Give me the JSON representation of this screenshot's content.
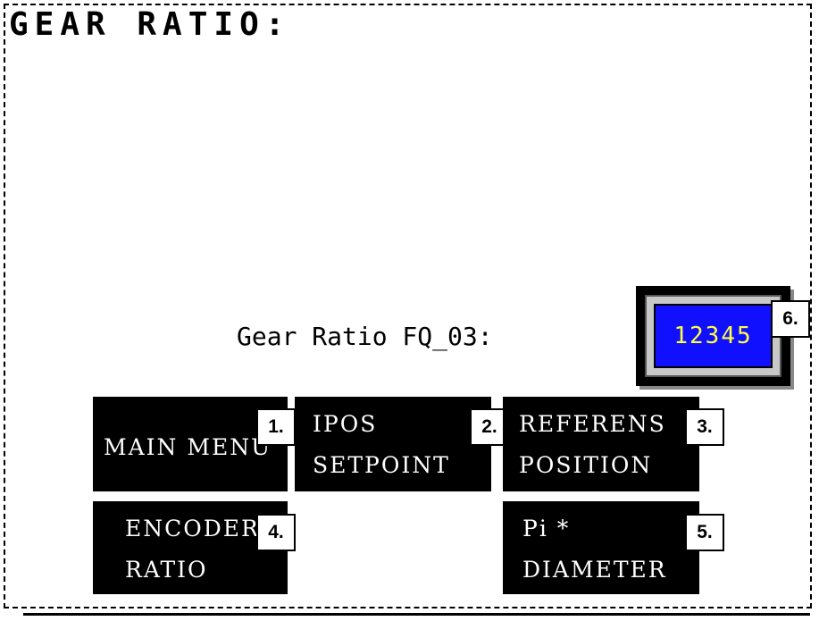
{
  "title": "GEAR RATIO:",
  "field": {
    "label": "Gear Ratio FQ_03:",
    "value": "12345",
    "value_badge": "6.",
    "value_color": "#ffff40",
    "box_color": "#1010ff"
  },
  "buttons": [
    {
      "id": "main-menu",
      "line1": "MAIN MENU",
      "line2": "",
      "badge": "1."
    },
    {
      "id": "ipos-setpoint",
      "line1": "IPOS",
      "line2": "SETPOINT",
      "badge": "2."
    },
    {
      "id": "referens-position",
      "line1": "REFERENS",
      "line2": "POSITION",
      "badge": "3."
    },
    {
      "id": "encoder-ratio",
      "line1": "ENCODER",
      "line2": "RATIO",
      "badge": "4."
    },
    {
      "id": "pi-diameter",
      "line1": "Pi *",
      "line2": "DIAMETER",
      "badge": "5."
    }
  ]
}
